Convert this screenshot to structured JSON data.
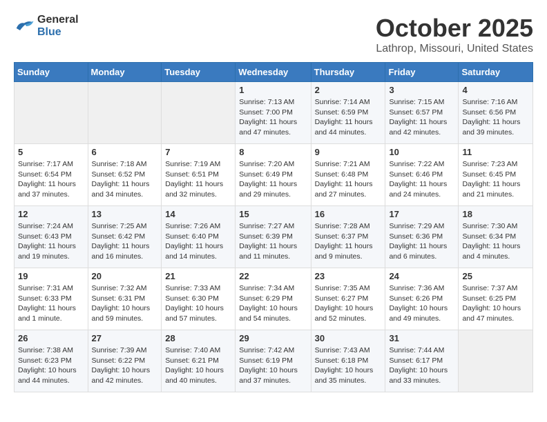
{
  "logo": {
    "general": "General",
    "blue": "Blue"
  },
  "title": "October 2025",
  "location": "Lathrop, Missouri, United States",
  "weekdays": [
    "Sunday",
    "Monday",
    "Tuesday",
    "Wednesday",
    "Thursday",
    "Friday",
    "Saturday"
  ],
  "weeks": [
    [
      {
        "day": "",
        "info": ""
      },
      {
        "day": "",
        "info": ""
      },
      {
        "day": "",
        "info": ""
      },
      {
        "day": "1",
        "info": "Sunrise: 7:13 AM\nSunset: 7:00 PM\nDaylight: 11 hours and 47 minutes."
      },
      {
        "day": "2",
        "info": "Sunrise: 7:14 AM\nSunset: 6:59 PM\nDaylight: 11 hours and 44 minutes."
      },
      {
        "day": "3",
        "info": "Sunrise: 7:15 AM\nSunset: 6:57 PM\nDaylight: 11 hours and 42 minutes."
      },
      {
        "day": "4",
        "info": "Sunrise: 7:16 AM\nSunset: 6:56 PM\nDaylight: 11 hours and 39 minutes."
      }
    ],
    [
      {
        "day": "5",
        "info": "Sunrise: 7:17 AM\nSunset: 6:54 PM\nDaylight: 11 hours and 37 minutes."
      },
      {
        "day": "6",
        "info": "Sunrise: 7:18 AM\nSunset: 6:52 PM\nDaylight: 11 hours and 34 minutes."
      },
      {
        "day": "7",
        "info": "Sunrise: 7:19 AM\nSunset: 6:51 PM\nDaylight: 11 hours and 32 minutes."
      },
      {
        "day": "8",
        "info": "Sunrise: 7:20 AM\nSunset: 6:49 PM\nDaylight: 11 hours and 29 minutes."
      },
      {
        "day": "9",
        "info": "Sunrise: 7:21 AM\nSunset: 6:48 PM\nDaylight: 11 hours and 27 minutes."
      },
      {
        "day": "10",
        "info": "Sunrise: 7:22 AM\nSunset: 6:46 PM\nDaylight: 11 hours and 24 minutes."
      },
      {
        "day": "11",
        "info": "Sunrise: 7:23 AM\nSunset: 6:45 PM\nDaylight: 11 hours and 21 minutes."
      }
    ],
    [
      {
        "day": "12",
        "info": "Sunrise: 7:24 AM\nSunset: 6:43 PM\nDaylight: 11 hours and 19 minutes."
      },
      {
        "day": "13",
        "info": "Sunrise: 7:25 AM\nSunset: 6:42 PM\nDaylight: 11 hours and 16 minutes."
      },
      {
        "day": "14",
        "info": "Sunrise: 7:26 AM\nSunset: 6:40 PM\nDaylight: 11 hours and 14 minutes."
      },
      {
        "day": "15",
        "info": "Sunrise: 7:27 AM\nSunset: 6:39 PM\nDaylight: 11 hours and 11 minutes."
      },
      {
        "day": "16",
        "info": "Sunrise: 7:28 AM\nSunset: 6:37 PM\nDaylight: 11 hours and 9 minutes."
      },
      {
        "day": "17",
        "info": "Sunrise: 7:29 AM\nSunset: 6:36 PM\nDaylight: 11 hours and 6 minutes."
      },
      {
        "day": "18",
        "info": "Sunrise: 7:30 AM\nSunset: 6:34 PM\nDaylight: 11 hours and 4 minutes."
      }
    ],
    [
      {
        "day": "19",
        "info": "Sunrise: 7:31 AM\nSunset: 6:33 PM\nDaylight: 11 hours and 1 minute."
      },
      {
        "day": "20",
        "info": "Sunrise: 7:32 AM\nSunset: 6:31 PM\nDaylight: 10 hours and 59 minutes."
      },
      {
        "day": "21",
        "info": "Sunrise: 7:33 AM\nSunset: 6:30 PM\nDaylight: 10 hours and 57 minutes."
      },
      {
        "day": "22",
        "info": "Sunrise: 7:34 AM\nSunset: 6:29 PM\nDaylight: 10 hours and 54 minutes."
      },
      {
        "day": "23",
        "info": "Sunrise: 7:35 AM\nSunset: 6:27 PM\nDaylight: 10 hours and 52 minutes."
      },
      {
        "day": "24",
        "info": "Sunrise: 7:36 AM\nSunset: 6:26 PM\nDaylight: 10 hours and 49 minutes."
      },
      {
        "day": "25",
        "info": "Sunrise: 7:37 AM\nSunset: 6:25 PM\nDaylight: 10 hours and 47 minutes."
      }
    ],
    [
      {
        "day": "26",
        "info": "Sunrise: 7:38 AM\nSunset: 6:23 PM\nDaylight: 10 hours and 44 minutes."
      },
      {
        "day": "27",
        "info": "Sunrise: 7:39 AM\nSunset: 6:22 PM\nDaylight: 10 hours and 42 minutes."
      },
      {
        "day": "28",
        "info": "Sunrise: 7:40 AM\nSunset: 6:21 PM\nDaylight: 10 hours and 40 minutes."
      },
      {
        "day": "29",
        "info": "Sunrise: 7:42 AM\nSunset: 6:19 PM\nDaylight: 10 hours and 37 minutes."
      },
      {
        "day": "30",
        "info": "Sunrise: 7:43 AM\nSunset: 6:18 PM\nDaylight: 10 hours and 35 minutes."
      },
      {
        "day": "31",
        "info": "Sunrise: 7:44 AM\nSunset: 6:17 PM\nDaylight: 10 hours and 33 minutes."
      },
      {
        "day": "",
        "info": ""
      }
    ]
  ]
}
